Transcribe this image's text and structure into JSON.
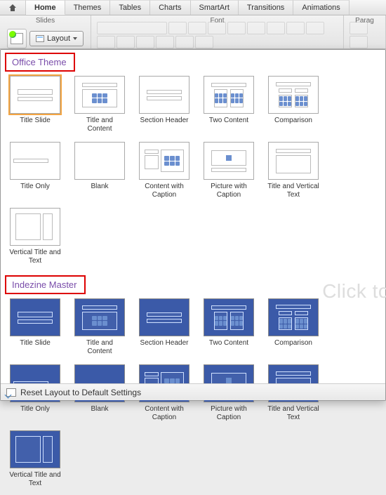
{
  "ribbon": {
    "tabs": [
      "Home",
      "Themes",
      "Tables",
      "Charts",
      "SmartArt",
      "Transitions",
      "Animations"
    ],
    "active_tab": "Home",
    "groups": {
      "slides": "Slides",
      "font": "Font",
      "paragraph": "Parag"
    },
    "layout_button": "Layout"
  },
  "sections": [
    {
      "title": "Office Theme",
      "theme_class": "light",
      "layouts": [
        "Title Slide",
        "Title and Content",
        "Section Header",
        "Two Content",
        "Comparison",
        "Title Only",
        "Blank",
        "Content with Caption",
        "Picture with Caption",
        "Title and Vertical Text",
        "Vertical Title and Text"
      ],
      "selected_index": 0
    },
    {
      "title": "Indezine Master",
      "theme_class": "dark",
      "layouts": [
        "Title Slide",
        "Title and Content",
        "Section Header",
        "Two Content",
        "Comparison",
        "Title Only",
        "Blank",
        "Content with Caption",
        "Picture with Caption",
        "Title and Vertical Text",
        "Vertical Title and Text"
      ]
    }
  ],
  "footer": {
    "reset_label": "Reset Layout to Default Settings"
  },
  "background_text": "Click to"
}
